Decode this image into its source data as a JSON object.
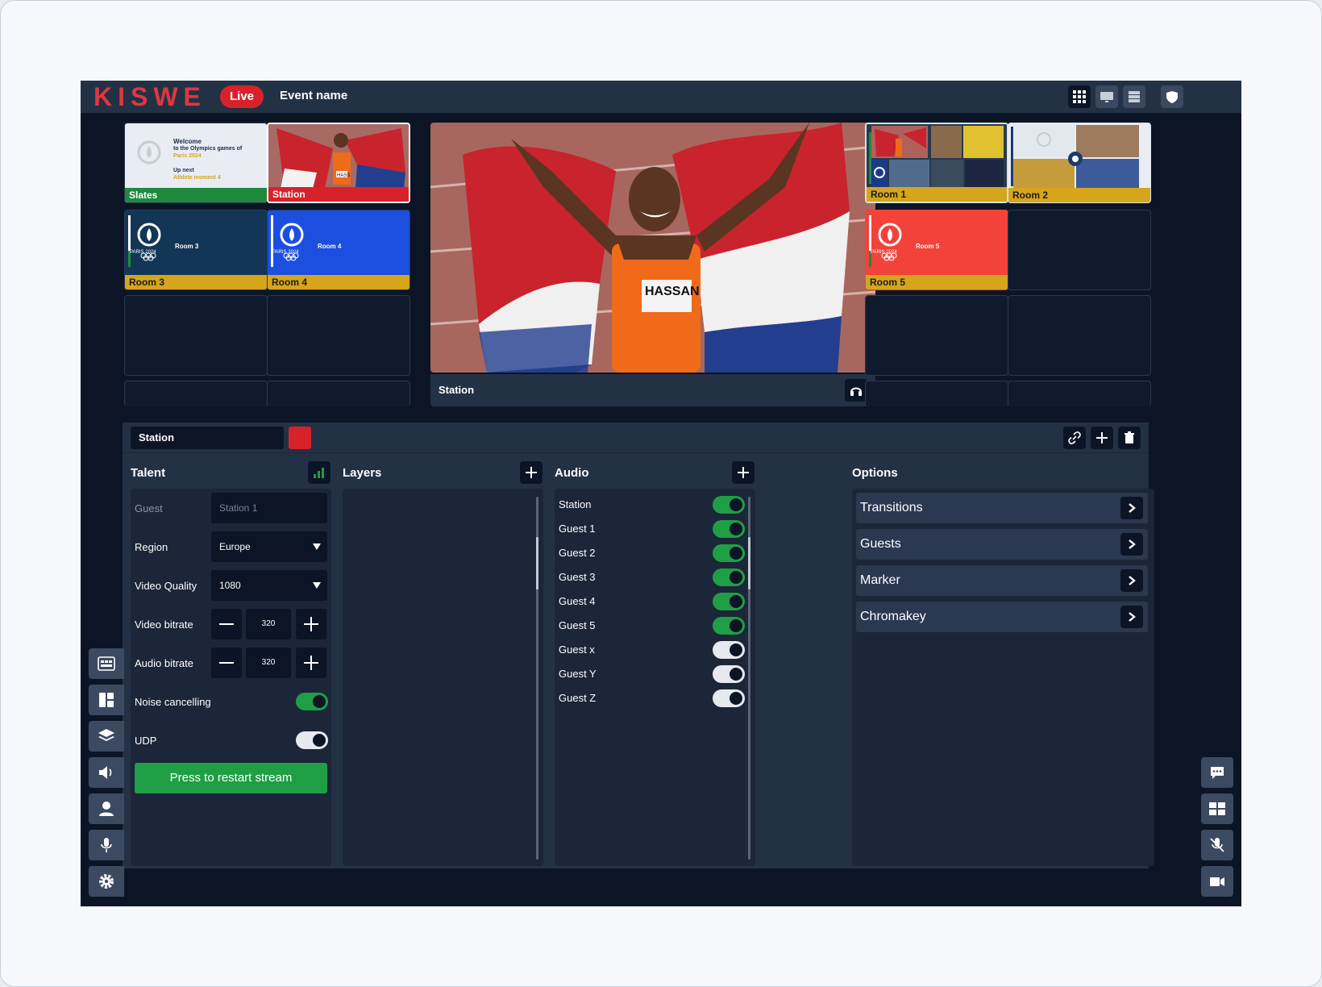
{
  "header": {
    "logo": "KISWE",
    "live_label": "Live",
    "event_name": "Event name"
  },
  "tiles": {
    "slates": {
      "label": "Slates",
      "welcome": "Welcome",
      "welcome_line2": "to the Olympics games of",
      "city": "Paris 2024",
      "upnext": "Up next",
      "upnext_item": "Athlete moment 4"
    },
    "station": {
      "label": "Station"
    },
    "room1": {
      "label": "Room 1"
    },
    "room2": {
      "label": "Room 2"
    },
    "room3": {
      "label": "Room 3",
      "inner": "Room 3"
    },
    "room4": {
      "label": "Room 4",
      "inner": "Room 4"
    },
    "room5": {
      "label": "Room 5",
      "inner": "Room 5"
    },
    "paris_mark": "PARIS 2024"
  },
  "preview": {
    "label": "Station",
    "bib": "HASSAN"
  },
  "controls": {
    "name": "Station",
    "accent": "#d8222b",
    "talent": {
      "title": "Talent",
      "guest_label": "Guest",
      "guest_placeholder": "Station 1",
      "region_label": "Region",
      "region_value": "Europe",
      "quality_label": "Video Quality",
      "quality_value": "1080",
      "vbitrate_label": "Video bitrate",
      "vbitrate_value": "320",
      "abitrate_label": "Audio bitrate",
      "abitrate_value": "320",
      "noise_label": "Noise cancelling",
      "udp_label": "UDP",
      "restart_label": "Press to restart stream"
    },
    "layers": {
      "title": "Layers"
    },
    "audio": {
      "title": "Audio",
      "items": [
        {
          "name": "Station",
          "on": true
        },
        {
          "name": "Guest 1",
          "on": true
        },
        {
          "name": "Guest 2",
          "on": true
        },
        {
          "name": "Guest 3",
          "on": true
        },
        {
          "name": "Guest 4",
          "on": true
        },
        {
          "name": "Guest 5",
          "on": true
        },
        {
          "name": "Guest x",
          "on": false
        },
        {
          "name": "Guest Y",
          "on": false
        },
        {
          "name": "Guest Z",
          "on": false
        }
      ]
    },
    "options": {
      "title": "Options",
      "items": [
        "Transitions",
        "Guests",
        "Marker",
        "Chromakey"
      ]
    }
  },
  "colors": {
    "background": "#0c1526",
    "panel": "#233145",
    "accent_red": "#d8222b",
    "accent_green": "#1f9e45",
    "accent_yellow": "#d5a51c"
  }
}
